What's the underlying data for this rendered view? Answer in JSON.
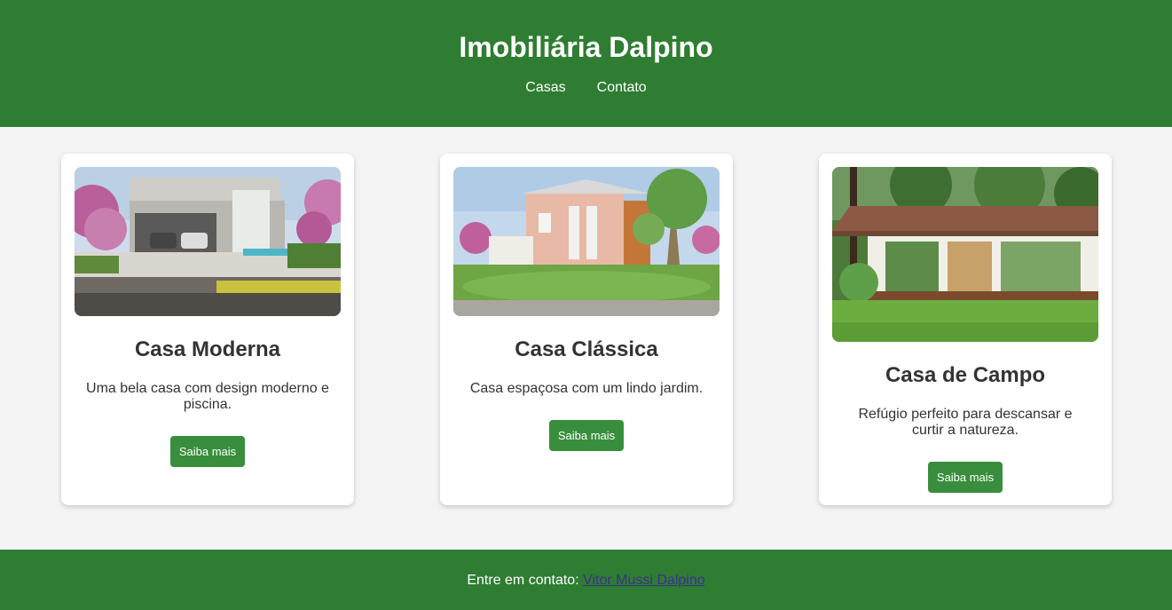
{
  "header": {
    "title": "Imobiliária Dalpino",
    "nav": [
      {
        "label": "Casas"
      },
      {
        "label": "Contato"
      }
    ]
  },
  "cards": [
    {
      "title": "Casa Moderna",
      "description": "Uma bela casa com design moderno e piscina.",
      "button": "Saiba mais",
      "image": "modern-house-photo"
    },
    {
      "title": "Casa Clássica",
      "description": "Casa espaçosa com um lindo jardim.",
      "button": "Saiba mais",
      "image": "classic-house-photo"
    },
    {
      "title": "Casa de Campo",
      "description": "Refúgio perfeito para descansar e curtir a natureza.",
      "button": "Saiba mais",
      "image": "country-house-photo"
    }
  ],
  "footer": {
    "text": "Entre em contato:",
    "link": "Vitor Mussi Dalpino"
  },
  "colors": {
    "primary": "#2e7d32",
    "button": "#388e3c",
    "background": "#f4f4f4",
    "link": "#3d2e8c"
  }
}
